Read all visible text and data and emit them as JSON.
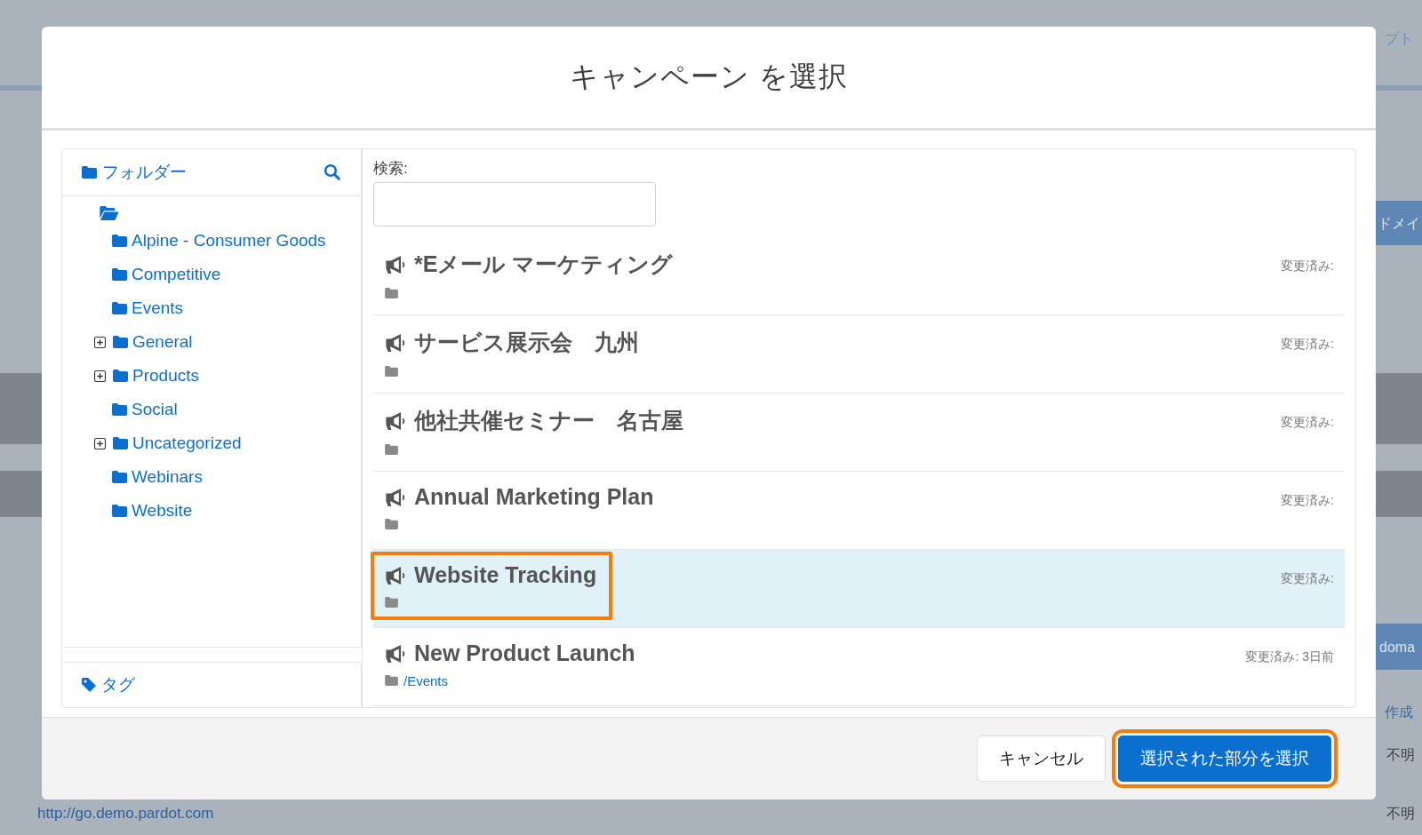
{
  "background": {
    "fragments": [
      "プト",
      "ドメイ",
      "doma",
      "作成",
      "不明",
      "http://go.demo.pardot.com",
      "不明"
    ]
  },
  "dialog": {
    "title": "キャンペーン を選択",
    "folders": {
      "heading": "フォルダー",
      "tree": [
        {
          "expanded": true,
          "children": [
            {
              "label": "Alpine - Consumer Goods"
            },
            {
              "label": "Competitive"
            },
            {
              "label": "Events"
            },
            {
              "label": "General",
              "expanded": false
            },
            {
              "label": "Products",
              "expanded": false
            },
            {
              "label": "Social"
            },
            {
              "label": "Uncategorized",
              "expanded": false
            },
            {
              "label": "Webinars"
            },
            {
              "label": "Website"
            }
          ]
        }
      ]
    },
    "tags": {
      "heading": "タグ"
    },
    "search": {
      "label": "検索:"
    },
    "campaigns": [
      {
        "name": "*Eメール マーケティング",
        "modified": "変更済み:",
        "selected": false,
        "annotated": false
      },
      {
        "name": "サービス展示会　九州",
        "modified": "変更済み:",
        "selected": false,
        "annotated": false
      },
      {
        "name": "他社共催セミナー　名古屋",
        "modified": "変更済み:",
        "selected": false,
        "annotated": false
      },
      {
        "name": "Annual Marketing Plan",
        "modified": "変更済み:",
        "selected": false,
        "annotated": false
      },
      {
        "name": "Website Tracking",
        "modified": "変更済み:",
        "selected": true,
        "annotated": true
      },
      {
        "name": "New Product Launch",
        "folder": "/Events",
        "modified": "変更済み: 3日前",
        "selected": false,
        "annotated": false
      }
    ],
    "buttons": [
      {
        "label": "キャンセル",
        "kind": "neutral",
        "annotated": false
      },
      {
        "label": "選択された部分を選択",
        "kind": "brand",
        "annotated": true
      }
    ]
  }
}
